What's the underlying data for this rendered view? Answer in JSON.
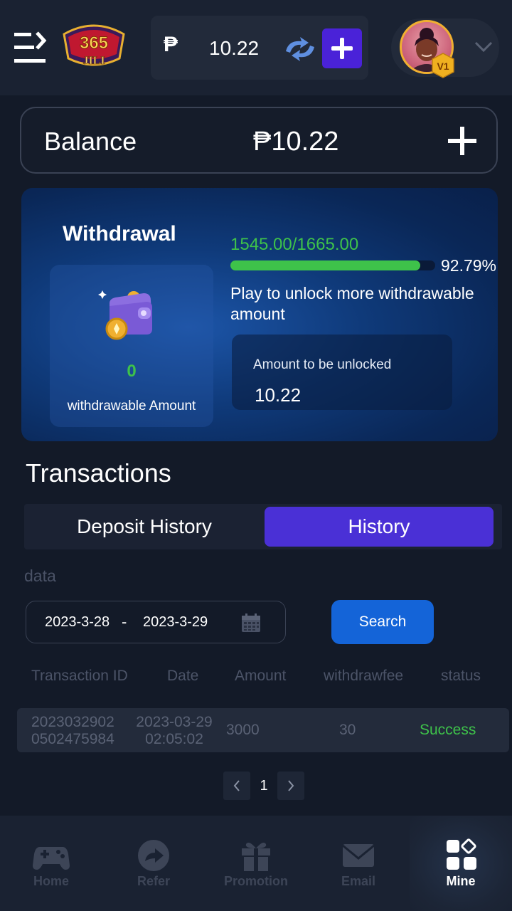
{
  "header": {
    "currency_symbol": "₱",
    "wallet_amount": "10.22"
  },
  "balance": {
    "label": "Balance",
    "value": "₱10.22"
  },
  "withdrawal": {
    "title": "Withdrawal",
    "withdrawable_value": "0",
    "withdrawable_label": "withdrawable Amount",
    "progress_text": "1545.00/1665.00",
    "progress_fraction": 0.9279,
    "progress_percent": "92.79%",
    "unlock_message": "Play to unlock more withdrawable amount",
    "unlock_label": "Amount to be unlocked",
    "unlock_value": "10.22"
  },
  "transactions": {
    "title": "Transactions",
    "tabs": [
      {
        "label": "Deposit History",
        "active": false
      },
      {
        "label": "History",
        "active": true
      }
    ],
    "data_label": "data",
    "date_start": "2023-3-28",
    "date_separator": "-",
    "date_end": "2023-3-29",
    "search_label": "Search",
    "columns": [
      "Transaction ID",
      "Date",
      "Amount",
      "withdrawfee",
      "status"
    ],
    "rows": [
      {
        "id_line1": "2023032902",
        "id_line2": "0502475984",
        "date_line1": "2023-03-29",
        "date_line2": "02:05:02",
        "amount": "3000",
        "fee": "30",
        "status": "Success"
      }
    ],
    "current_page": "1"
  },
  "nav": {
    "items": [
      {
        "label": "Home",
        "icon": "gamepad-icon"
      },
      {
        "label": "Refer",
        "icon": "share-icon"
      },
      {
        "label": "Promotion",
        "icon": "gift-icon"
      },
      {
        "label": "Email",
        "icon": "mail-icon"
      },
      {
        "label": "Mine",
        "icon": "apps-icon",
        "active": true
      }
    ]
  },
  "colors": {
    "background": "#131a28",
    "accent_purple": "#4a30d6",
    "search_blue": "#1464d8",
    "success_green": "#3ec24a"
  }
}
